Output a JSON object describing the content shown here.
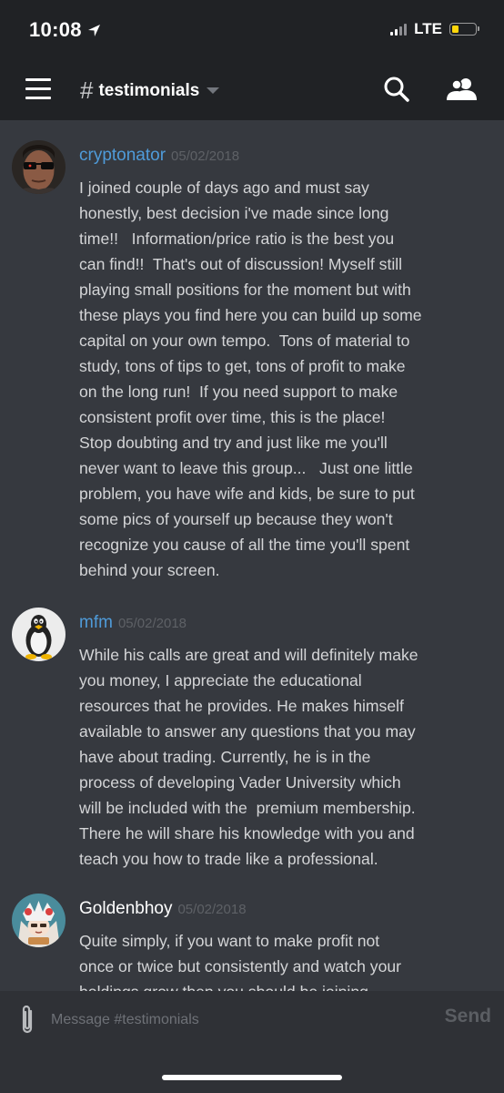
{
  "status_bar": {
    "time": "10:08",
    "network": "LTE",
    "battery_level": 0.3,
    "battery_color": "#ffd60a"
  },
  "header": {
    "channel_hash": "#",
    "channel_name": "testimonials"
  },
  "messages": [
    {
      "author": "cryptonator",
      "author_color": "#4f9bd9",
      "timestamp": "05/02/2018",
      "avatar_icon": "sunglasses-man-avatar",
      "text": "I joined couple of days ago and must say\nhonestly, best decision i've made since long\ntime!!   Information/price ratio is the best you\ncan find!!  That's out of discussion! Myself still\nplaying small positions for the moment but with\nthese plays you find here you can build up some\ncapital on your own tempo.  Tons of material to\nstudy, tons of tips to get, tons of profit to make\non the long run!  If you need support to make\nconsistent profit over time, this is the place!\nStop doubting and try and just like me you'll\nnever want to leave this group...   Just one little\nproblem, you have wife and kids, be sure to put\nsome pics of yourself up because they won't\nrecognize you cause of all the time you'll spent\nbehind your screen."
    },
    {
      "author": "mfm",
      "author_color": "#4f9bd9",
      "timestamp": "05/02/2018",
      "avatar_icon": "penguin-avatar",
      "text": "While his calls are great and will definitely make\nyou money, I appreciate the educational\nresources that he provides. He makes himself\navailable to answer any questions that you may\nhave about trading. Currently, he is in the\nprocess of developing Vader University which\nwill be included with the  premium membership.\nThere he will share his knowledge with you and\nteach you how to trade like a professional."
    },
    {
      "author": "Goldenbhoy",
      "author_color": "#ffffff",
      "timestamp": "05/02/2018",
      "avatar_icon": "anime-character-avatar",
      "text": "Quite simply, if you want to make profit not\nonce or twice but consistently and watch your\nholdings grow then you should be joining"
    }
  ],
  "composer": {
    "placeholder": "Message #testimonials",
    "send_label": "Send"
  }
}
